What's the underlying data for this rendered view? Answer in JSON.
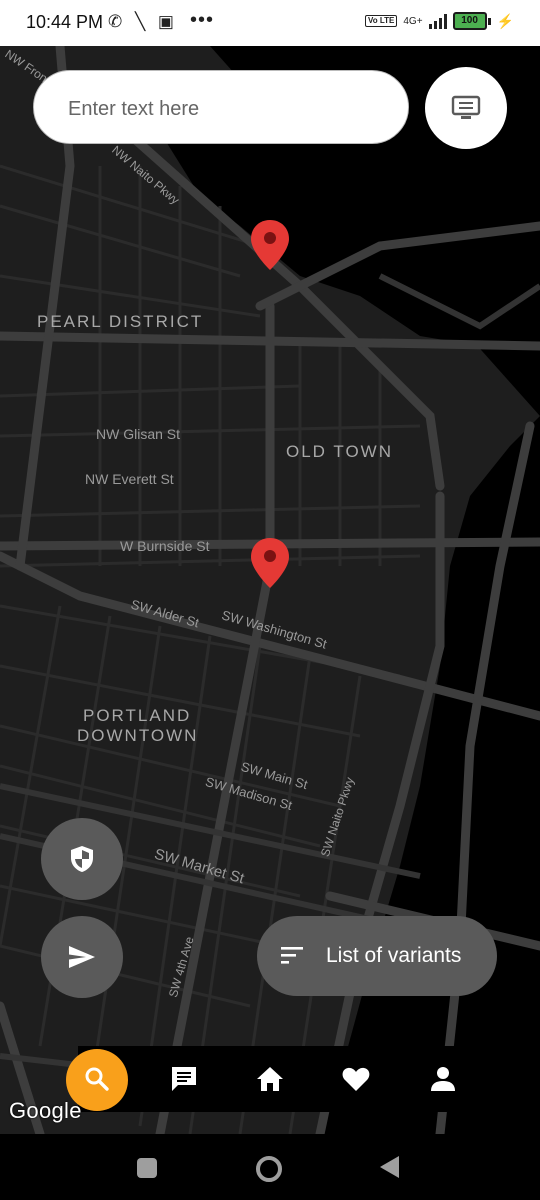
{
  "status_bar": {
    "time": "10:44 PM",
    "left_icons": "✆ ╲ ▣",
    "more": "•••",
    "volte": "Vo LTE",
    "network": "4G+",
    "battery": "100"
  },
  "search": {
    "placeholder": "Enter text here",
    "value": ""
  },
  "map": {
    "streets": {
      "nw_front": "NW Front",
      "nw_naito": "NW Naito Pkwy",
      "nw_glisan": "NW Glisan St",
      "nw_everett": "NW Everett St",
      "w_burnside": "W Burnside St",
      "sw_alder": "SW Alder St",
      "sw_washington": "SW Washington St",
      "sw_main": "SW Main St",
      "sw_madison": "SW Madison St",
      "sw_naito": "SW Naito Pkwy",
      "sw_market": "SW Market St",
      "sw_4th": "SW 4th Ave"
    },
    "districts": {
      "pearl": "PEARL DISTRICT",
      "old_town": "OLD TOWN",
      "downtown_1": "PORTLAND",
      "downtown_2": "DOWNTOWN"
    },
    "pin_color": "#e53935",
    "brand": "Google"
  },
  "variants": {
    "label": "List of variants"
  },
  "colors": {
    "accent": "#f9a01b",
    "fab": "#5a5a5a"
  }
}
